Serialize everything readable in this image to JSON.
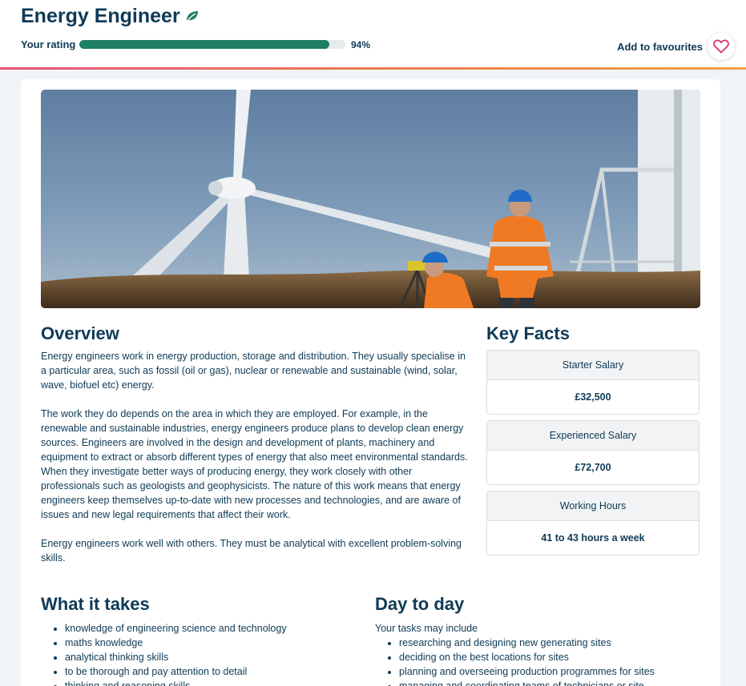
{
  "header": {
    "title": "Energy Engineer",
    "title_icon": "leaf-icon",
    "rating_label": "Your rating",
    "rating_value": 0.94,
    "rating_text": "94%",
    "favourites_label": "Add to favourites",
    "favourites_icon": "heart-icon"
  },
  "colors": {
    "brand": "#0e3a56",
    "rating_fill": "#1f7f63",
    "heart": "#d6336c",
    "accent_start": "#e8527a",
    "accent_end": "#f3a03f"
  },
  "hero": {
    "image": "energy-engineers-wind-turbine-photo"
  },
  "overview": {
    "heading": "Overview",
    "paragraphs": [
      "Energy engineers work in energy production, storage and distribution. They usually specialise in a particular area, such as fossil (oil or gas), nuclear or renewable and sustainable (wind, solar, wave, biofuel etc) energy.",
      "The work they do depends on the area in which they are employed. For example, in the renewable and sustainable industries, energy engineers produce plans to develop clean energy sources. Engineers are involved in the design and development of plants, machinery and equipment to extract or absorb different types of energy that also meet environmental standards. When they investigate better ways of producing energy, they work closely with other professionals such as geologists and geophysicists. The nature of this work means that energy engineers keep themselves up-to-date with new processes and technologies, and are aware of issues and new legal requirements that affect their work.",
      "Energy engineers work well with others. They must be analytical with excellent problem-solving skills."
    ]
  },
  "key_facts": {
    "heading": "Key Facts",
    "items": [
      {
        "label": "Starter Salary",
        "value": "£32,500"
      },
      {
        "label": "Experienced Salary",
        "value": "£72,700"
      },
      {
        "label": "Working Hours",
        "value": "41 to 43 hours a week"
      }
    ]
  },
  "what_it_takes": {
    "heading": "What it takes",
    "items": [
      "knowledge of engineering science and technology",
      "maths knowledge",
      "analytical thinking skills",
      "to be thorough and pay attention to detail",
      "thinking and reasoning skills"
    ]
  },
  "day_to_day": {
    "heading": "Day to day",
    "intro": "Your tasks may include",
    "items": [
      "researching and designing new generating sites",
      "deciding on the best locations for sites",
      "planning and overseeing production programmes for sites",
      "managing and coordinating teams of technicians or site"
    ]
  }
}
